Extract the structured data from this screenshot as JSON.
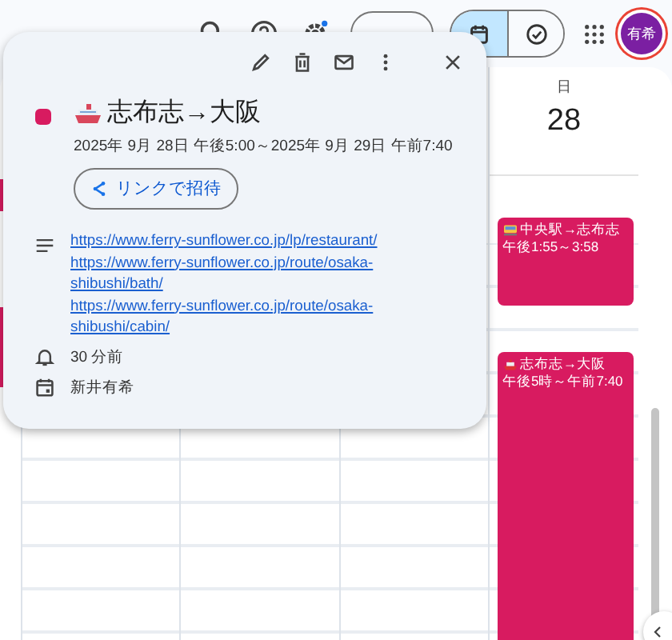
{
  "toolbar": {
    "avatar": "有希",
    "settings_badge": true,
    "view_toggle": [
      {
        "kind": "calendar",
        "selected": true
      },
      {
        "kind": "tasks",
        "selected": false
      }
    ]
  },
  "day_column": {
    "weekday": "日",
    "date": "28"
  },
  "events": [
    {
      "kind": "train",
      "title": "中央駅→志布志",
      "time": "午後1:55～3:58"
    },
    {
      "kind": "ship",
      "title": "志布志→大阪",
      "time": "午後5時～午前7:40"
    }
  ],
  "popup": {
    "kind": "ship",
    "color": "#d81b60",
    "title": "志布志→大阪",
    "datetime": "2025年 9月 28日 午後5:00～2025年 9月 29日 午前7:40",
    "invite_button": "リンクで招待",
    "links": [
      "https://www.ferry-sunflower.co.jp/lp/restaurant/",
      "https://www.ferry-sunflower.co.jp/route/osaka-shibushi/bath/",
      "https://www.ferry-sunflower.co.jp/route/osaka-shibushi/cabin/"
    ],
    "reminder": "30 分前",
    "calendar": "新井有希"
  }
}
